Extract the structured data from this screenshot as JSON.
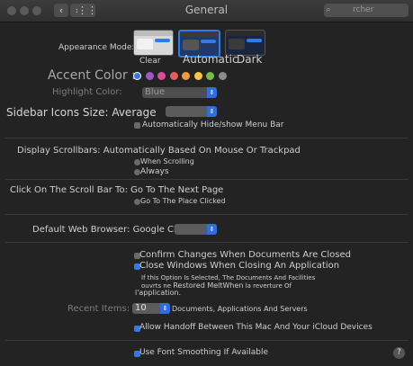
{
  "window": {
    "title": "General",
    "search_placeholder": "rcher"
  },
  "appearance": {
    "label": "Appearance Mode:",
    "options": [
      "Clear",
      "Automatic",
      "Dark"
    ]
  },
  "accent": {
    "label": "Accent Color :",
    "colors": [
      "#2f7bea",
      "#9d58c6",
      "#e0489a",
      "#e85c5e",
      "#f39a3e",
      "#f5c843",
      "#72c04a",
      "#8c8c8c"
    ]
  },
  "highlight": {
    "label": "Highlight Color:",
    "value": "Blue"
  },
  "sidebar_icons": {
    "label": "Sidebar Icons Size:",
    "value": "Average"
  },
  "menu_bar": {
    "label": "Automatically Hide/show Menu Bar"
  },
  "scrollbars": {
    "label": "Display Scrollbars: Automatically Based On Mouse Or Trackpad",
    "options": [
      "When Scrolling",
      "Always"
    ]
  },
  "scroll_click": {
    "label": "Click On The Scroll Bar To: Go To The Next Page",
    "option": "Go To The Place Clicked"
  },
  "browser": {
    "label": "Default Web Browser:",
    "value": "Google Chrome"
  },
  "documents": {
    "confirm_changes": "Confirm Changes When Documents Are Closed",
    "close_windows": "Close Windows When Closing An Application",
    "note_line1": "If this Option Is Selected, The Documents And Facilities",
    "note_line2_a": "ouvrts ne",
    "note_line2_b": "Restored MeltWhen",
    "note_line2_c": "la reverture Of",
    "note_line3": "l'application."
  },
  "recent": {
    "label": "Recent Items:",
    "value": "10",
    "suffix": "Documents, Applications And Servers"
  },
  "handoff": {
    "label": "Allow Handoff Between This Mac And Your iCloud Devices"
  },
  "font_smoothing": {
    "label": "Use Font Smoothing If Available"
  },
  "help": "?"
}
